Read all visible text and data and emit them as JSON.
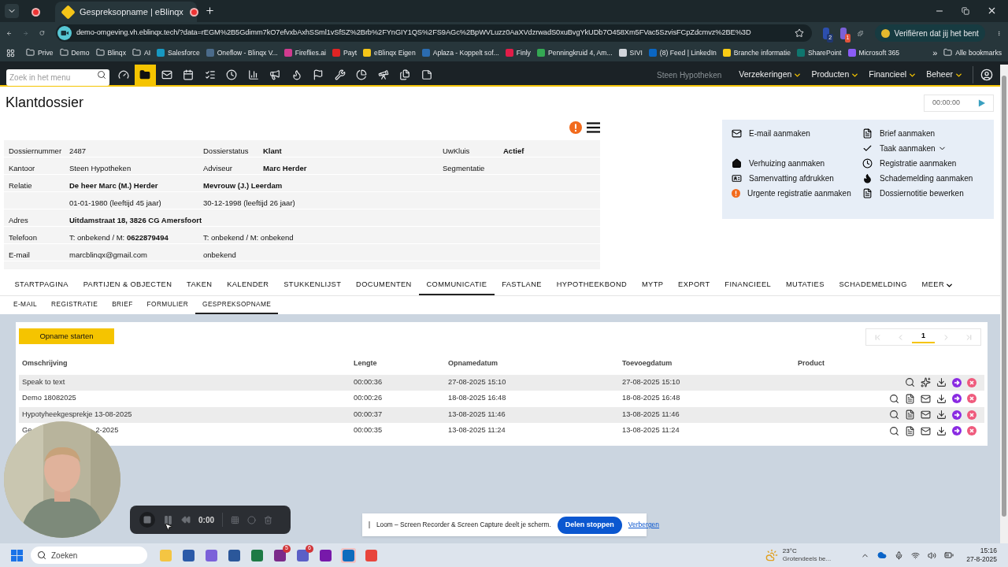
{
  "browser": {
    "tabs": [
      {
        "selected": false
      },
      {
        "title": "Gespreksopname | eBlinqx",
        "selected": true
      }
    ],
    "url": "demo-omgeving.vh.eblinqx.tech/?data=rEGM%2B5Gdimm7kO7efvxbAxhSSml1vSfSZ%2Brb%2FYnGIY1QS%2FS9AGc%2BpWVLuzz0AaXVdzrwadS0xuBvgYkUDb7O458Xm5FVac5SzvisFCpZdcmvz%2BE%3D",
    "extension_badges": [
      "2",
      "1"
    ],
    "profile_button": "Verifiëren dat jij het bent",
    "bookmarks": [
      {
        "label": "Prive",
        "kind": "folder"
      },
      {
        "label": "Demo",
        "kind": "folder"
      },
      {
        "label": "Blinqx",
        "kind": "folder"
      },
      {
        "label": "AI",
        "kind": "folder"
      },
      {
        "label": "Salesforce",
        "kind": "site",
        "color": "#1798c1"
      },
      {
        "label": "Oneflow - Blinqx V...",
        "kind": "site",
        "color": "#4b6b8a"
      },
      {
        "label": "Fireflies.ai",
        "kind": "site",
        "color": "#d13b8f"
      },
      {
        "label": "Payt",
        "kind": "site",
        "color": "#e02424"
      },
      {
        "label": "eBlinqx Eigen",
        "kind": "site",
        "color": "#f5c518"
      },
      {
        "label": "Aplaza - Koppelt sof...",
        "kind": "site",
        "color": "#2b6cb0"
      },
      {
        "label": "Finly",
        "kind": "site",
        "color": "#e11d48"
      },
      {
        "label": "Penningkruid 4, Am...",
        "kind": "site",
        "color": "#34a853"
      },
      {
        "label": "SIVI",
        "kind": "site",
        "color": "#d1d5db"
      },
      {
        "label": "(8) Feed | LinkedIn",
        "kind": "site",
        "color": "#0a66c2"
      },
      {
        "label": "Branche informatie",
        "kind": "site",
        "color": "#facc15"
      },
      {
        "label": "SharePoint",
        "kind": "site",
        "color": "#0f766e"
      },
      {
        "label": "Microsoft 365",
        "kind": "site",
        "color": "#8b5cf6"
      }
    ],
    "more_bookmarks": "»",
    "all_bookmarks": "Alle bookmarks"
  },
  "app_nav": {
    "search_placeholder": "Zoek in het menu",
    "icons": [
      {
        "selected": false
      },
      {
        "selected": true
      },
      {
        "selected": false
      },
      {
        "selected": false
      },
      {
        "selected": false
      },
      {
        "selected": false
      },
      {
        "selected": false
      },
      {
        "selected": false
      },
      {
        "selected": false
      },
      {
        "selected": false
      },
      {
        "selected": false
      },
      {
        "selected": false
      },
      {
        "selected": false
      },
      {
        "selected": false
      },
      {
        "selected": false
      }
    ],
    "office": "Steen Hypotheken",
    "menus": [
      "Verzekeringen",
      "Producten",
      "Financieel",
      "Beheer"
    ]
  },
  "page": {
    "title": "Klantdossier",
    "timer": "00:00:00",
    "dossier_rows": [
      [
        {
          "text": "Dossiernummer"
        },
        {
          "text": "2487"
        },
        {
          "text": "Dossierstatus"
        },
        {
          "text": "Klant",
          "bold": true
        },
        {
          "text": "UwKluis"
        },
        {
          "text": "Actief",
          "bold": true
        }
      ],
      [
        {
          "text": "Kantoor"
        },
        {
          "text": "Steen Hypotheken"
        },
        {
          "text": "Adviseur"
        },
        {
          "text": "Marc Herder",
          "bold": true
        },
        {
          "text": "Segmentatie"
        },
        null
      ],
      [
        {
          "text": "Relatie"
        },
        {
          "text": "De heer Marc (M.) Herder",
          "bold": true
        },
        {
          "text": "Mevrouw (J.) Leerdam",
          "bold": true
        },
        null,
        null,
        null
      ],
      [
        null,
        {
          "text": "01-01-1980 (leeftijd 45 jaar)"
        },
        {
          "text": "30-12-1998 (leeftijd 26 jaar)"
        },
        null,
        null,
        null
      ],
      [
        {
          "text": "Adres"
        },
        {
          "text": "Uitdamstraat 18, 3826 CG Amersfoort",
          "bold": true
        },
        null,
        null,
        null,
        null
      ],
      [
        {
          "text": "Telefoon"
        },
        {
          "text": "T: onbekend / M: **0622879494**"
        },
        {
          "text": "T: onbekend / M: onbekend"
        },
        null,
        null,
        null
      ],
      [
        {
          "text": "E-mail"
        },
        {
          "text": "marcblinqx@gmail.com"
        },
        {
          "text": "onbekend"
        },
        null,
        null,
        null
      ]
    ],
    "actions": [
      {
        "left": {
          "label": "E-mail aanmaken"
        },
        "right": {
          "label": "Brief aanmaken"
        }
      },
      {
        "right": {
          "label": "Taak aanmaken",
          "dropdown": true
        }
      },
      {
        "left": {
          "label": "Verhuizing aanmaken"
        },
        "right": {
          "label": "Registratie aanmaken"
        }
      },
      {
        "left": {
          "label": "Samenvatting afdrukken"
        },
        "right": {
          "label": "Schademelding aanmaken"
        }
      },
      {
        "left": {
          "label": "Urgente registratie aanmaken"
        },
        "right": {
          "label": "Dossiernotitie bewerken"
        }
      }
    ],
    "tabs": [
      {
        "label": "STARTPAGINA",
        "selected": false
      },
      {
        "label": "PARTIJEN & OBJECTEN",
        "selected": false
      },
      {
        "label": "TAKEN",
        "selected": false
      },
      {
        "label": "KALENDER",
        "selected": false
      },
      {
        "label": "STUKKENLIJST",
        "selected": false
      },
      {
        "label": "DOCUMENTEN",
        "selected": false
      },
      {
        "label": "COMMUNICATIE",
        "selected": true
      },
      {
        "label": "FASTLANE",
        "selected": false
      },
      {
        "label": "HYPOTHEEKBOND",
        "selected": false
      },
      {
        "label": "MYTP",
        "selected": false
      },
      {
        "label": "EXPORT",
        "selected": false
      },
      {
        "label": "FINANCIEEL",
        "selected": false
      },
      {
        "label": "MUTATIES",
        "selected": false
      },
      {
        "label": "SCHADEMELDING",
        "selected": false
      },
      {
        "label": "MEER",
        "selected": false,
        "dropdown": true
      }
    ],
    "subtabs": [
      {
        "label": "E-MAIL",
        "selected": false
      },
      {
        "label": "REGISTRATIE",
        "selected": false
      },
      {
        "label": "BRIEF",
        "selected": false
      },
      {
        "label": "FORMULIER",
        "selected": false
      },
      {
        "label": "GESPREKSOPNAME",
        "selected": true
      }
    ],
    "start_button": "Opname starten",
    "pagination": {
      "page": "1"
    },
    "table": {
      "columns": [
        "Omschrijving",
        "Lengte",
        "Opnamedatum",
        "Toevoegdatum",
        "Product"
      ],
      "rows": [
        {
          "kind": "transcript",
          "description": [
            "Speak to text"
          ],
          "length": "00:00:36",
          "recorded": "27-08-2025 15:10",
          "added": "27-08-2025 15:10"
        },
        {
          "kind": "recording",
          "description": [
            "Demo 18082025"
          ],
          "length": "00:00:26",
          "recorded": "18-08-2025 16:48",
          "added": "18-08-2025 16:48"
        },
        {
          "kind": "recording",
          "description": [
            "Hypotyheekgesprekje 13-08-2025"
          ],
          "length": "00:00:37",
          "recorded": "13-08-2025 11:46",
          "added": "13-08-2025 11:46"
        },
        {
          "kind": "recording",
          "description": [
            "Ge",
            "2-2025"
          ],
          "length": "00:00:35",
          "recorded": "13-08-2025 11:24",
          "added": "13-08-2025 11:24"
        }
      ]
    }
  },
  "recorder": {
    "time": "0:00"
  },
  "share_notice": {
    "text": "Loom – Screen Recorder & Screen Capture deelt je scherm.",
    "stop": "Delen stoppen",
    "hide": "Verbergen"
  },
  "taskbar": {
    "search": "Zoeken",
    "badges": [
      "5",
      "6"
    ],
    "weather_temp": "23°C",
    "weather_text": "Grotendeels be...",
    "time": "15:16",
    "date": "27-8-2025"
  }
}
